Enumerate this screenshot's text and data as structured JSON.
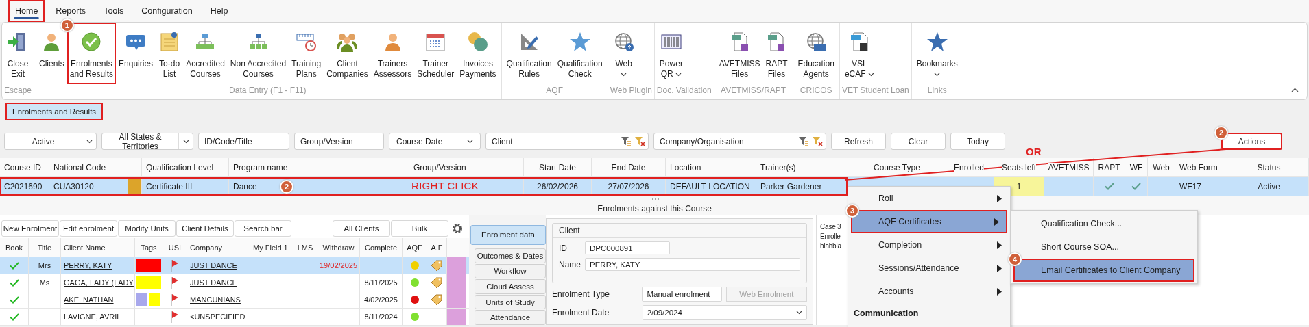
{
  "menu_tabs": [
    {
      "label": "Home",
      "selected": true,
      "annotated": true
    },
    {
      "label": "Reports",
      "selected": false,
      "annotated": false
    },
    {
      "label": "Tools",
      "selected": false,
      "annotated": false
    },
    {
      "label": "Configuration",
      "selected": false,
      "annotated": false
    },
    {
      "label": "Help",
      "selected": false,
      "annotated": false
    }
  ],
  "ribbon": {
    "groups": [
      {
        "label": "Escape",
        "buttons": [
          {
            "lines": [
              "Close",
              "Exit"
            ],
            "annotated": false
          }
        ]
      },
      {
        "label": "Data Entry (F1 - F11)",
        "buttons": [
          {
            "lines": [
              "Clients"
            ],
            "annotated": false
          },
          {
            "lines": [
              "Enrolments",
              "and Results"
            ],
            "annotated": true,
            "badge": "1"
          },
          {
            "lines": [
              "Enquiries"
            ],
            "annotated": false
          },
          {
            "lines": [
              "To-do",
              "List"
            ],
            "annotated": false
          },
          {
            "lines": [
              "Accredited",
              "Courses"
            ],
            "annotated": false
          },
          {
            "lines": [
              "Non Accredited",
              "Courses"
            ],
            "annotated": false
          },
          {
            "lines": [
              "Training",
              "Plans"
            ],
            "annotated": false
          },
          {
            "lines": [
              "Client",
              "Companies"
            ],
            "annotated": false
          },
          {
            "lines": [
              "Trainers",
              "Assessors"
            ],
            "annotated": false
          },
          {
            "lines": [
              "Trainer",
              "Scheduler"
            ],
            "annotated": false
          },
          {
            "lines": [
              "Invoices",
              "Payments"
            ],
            "annotated": false
          }
        ]
      },
      {
        "label": "AQF",
        "buttons": [
          {
            "lines": [
              "Qualification",
              "Rules"
            ],
            "annotated": false
          },
          {
            "lines": [
              "Qualification",
              "Check"
            ],
            "annotated": false
          }
        ]
      },
      {
        "label": "Web Plugin",
        "buttons": [
          {
            "lines": [
              "Web"
            ],
            "dropdown": true,
            "annotated": false
          }
        ]
      },
      {
        "label": "Doc. Validation",
        "buttons": [
          {
            "lines": [
              "Power",
              "QR"
            ],
            "dropdown": true,
            "annotated": false
          }
        ]
      },
      {
        "label": "AVETMISS/RAPT",
        "buttons": [
          {
            "lines": [
              "AVETMISS",
              "Files"
            ],
            "annotated": false
          },
          {
            "lines": [
              "RAPT",
              "Files"
            ],
            "annotated": false
          }
        ]
      },
      {
        "label": "CRICOS",
        "buttons": [
          {
            "lines": [
              "Education",
              "Agents"
            ],
            "annotated": false
          }
        ]
      },
      {
        "label": "VET Student Loan",
        "buttons": [
          {
            "lines": [
              "VSL",
              "eCAF"
            ],
            "dropdown": true,
            "annotated": false
          }
        ]
      },
      {
        "label": "Links",
        "buttons": [
          {
            "lines": [
              "Bookmarks"
            ],
            "dropdown": true,
            "annotated": false
          }
        ]
      }
    ]
  },
  "sub_tabs": [
    {
      "label": "Enrolments and Results",
      "selected": true,
      "annotated": true
    }
  ],
  "filters": {
    "status": "Active",
    "states": "All States & Territories",
    "id_code_title": {
      "placeholder": "ID/Code/Title"
    },
    "group_version": {
      "placeholder": "Group/Version"
    },
    "course_date": "Course Date",
    "client": {
      "placeholder": "Client"
    },
    "company": {
      "placeholder": "Company/Organisation"
    }
  },
  "buttons": [
    {
      "label": "Refresh",
      "annotated": false
    },
    {
      "label": "Clear",
      "annotated": false
    },
    {
      "label": "Today",
      "annotated": false
    },
    {
      "label": "Actions",
      "annotated": true,
      "badge": "2"
    }
  ],
  "or_label": "OR",
  "courses": {
    "columns": [
      "Course ID",
      "National Code",
      "Qualification Level",
      "Program name",
      "Group/Version",
      "Start Date",
      "End Date",
      "Location",
      "Trainer(s)",
      "Course Type",
      "Enrolled",
      "Seats left",
      "AVETMISS",
      "RAPT",
      "WF",
      "Web",
      "Web Form",
      "Status"
    ],
    "rows": [
      {
        "course_id": "C2021690",
        "national_code": "CUA30120",
        "color": "#dca42a",
        "qualification_level": "Certificate III",
        "program_name": "Dance",
        "start_date": "26/02/2026",
        "end_date": "27/07/2026",
        "location": "DEFAULT LOCATION",
        "trainers": "Parker Gardener",
        "seats_left": "1",
        "rapt": true,
        "wf": true,
        "web_form": "WF17",
        "status": "Active",
        "selected": true,
        "annotated": true,
        "badge": "2",
        "note": "RIGHT CLICK"
      }
    ]
  },
  "enrolments": {
    "title": "Enrolments against this Course",
    "toolbar": [
      "New Enrolment",
      "Edit enrolment",
      "Modify Units",
      "Client Details",
      "Search bar"
    ],
    "toolbar_right": [
      "All Clients",
      "Bulk"
    ],
    "columns": [
      "Book",
      "Title",
      "Client Name",
      "Tags",
      "USI",
      "Company",
      "My Field 1",
      "LMS",
      "Withdraw",
      "Complete",
      "AQF",
      "A.F"
    ],
    "rows": [
      {
        "booked": true,
        "title": "Mrs",
        "client_name": "PERRY, KATY",
        "linked": true,
        "tags": [
          {
            "color": "#ff0000"
          }
        ],
        "usi_flag": true,
        "company": "JUST DANCE",
        "withdraw": "19/02/2025",
        "aqf": {
          "color": "#f0d000"
        },
        "tagged": true,
        "selected": true
      },
      {
        "booked": true,
        "title": "Ms",
        "client_name": "GAGA, LADY (LADY",
        "linked": true,
        "tags": [
          {
            "color": "#ffff00"
          }
        ],
        "usi_flag": true,
        "company": "JUST DANCE",
        "completed": "8/11/2025",
        "aqf": {
          "color": "#80e030"
        },
        "tagged": true,
        "selected": false
      },
      {
        "booked": true,
        "client_name": "AKE, NATHAN",
        "linked": true,
        "tags": [
          {
            "color": "#a8a8ec"
          },
          {
            "color": "#ffff00"
          }
        ],
        "usi_flag": true,
        "company": "MANCUNIANS",
        "completed": "4/02/2025",
        "aqf": {
          "color": "#e01010"
        },
        "tagged": true,
        "selected": false
      },
      {
        "booked": true,
        "client_name": "LAVIGNE, AVRIL",
        "linked": false,
        "usi_flag": true,
        "company": "<UNSPECIFIED",
        "completed": "8/11/2024",
        "aqf": {
          "color": "#80e030"
        },
        "tagged": false,
        "selected": false
      }
    ]
  },
  "side_tabs": [
    {
      "label": "Enrolment data",
      "selected": true
    },
    {
      "label": "Outcomes & Dates",
      "selected": false
    },
    {
      "label": "Workflow",
      "selected": false
    },
    {
      "label": "Cloud Assess",
      "selected": false
    },
    {
      "label": "Units of Study",
      "selected": false
    },
    {
      "label": "Attendance",
      "selected": false
    }
  ],
  "detail": {
    "client_group": {
      "title": "Client",
      "id_label": "ID",
      "id": "DPC000891",
      "name_label": "Name",
      "name": "PERRY, KATY"
    },
    "enrolment_type": {
      "label": "Enrolment Type",
      "value": "Manual enrolment",
      "button": {
        "label": "Web Enrolment",
        "disabled": true
      }
    },
    "enrolment_date": {
      "label": "Enrolment Date",
      "value": "2/09/2024"
    }
  },
  "notes": [
    "Case 3",
    "Enrolle",
    "blahbla"
  ],
  "context_menu": {
    "items": [
      {
        "label": "Roll",
        "submenu": true,
        "selected": false,
        "annotated": false
      },
      {
        "label": "AQF Certificates",
        "submenu": true,
        "selected": true,
        "annotated": true,
        "badge": "3"
      },
      {
        "label": "Completion",
        "submenu": true,
        "selected": false,
        "annotated": false
      },
      {
        "label": "Sessions/Attendance",
        "submenu": true,
        "selected": false,
        "annotated": false
      },
      {
        "label": "Accounts",
        "submenu": true,
        "selected": false,
        "annotated": false
      }
    ],
    "section": "Communication",
    "submenu": [
      {
        "label": "Qualification Check...",
        "selected": false,
        "annotated": false
      },
      {
        "label": "Short Course SOA...",
        "selected": false,
        "annotated": false
      },
      {
        "label": "Email Certificates to Client Company",
        "selected": true,
        "annotated": true,
        "badge": "4"
      }
    ]
  }
}
